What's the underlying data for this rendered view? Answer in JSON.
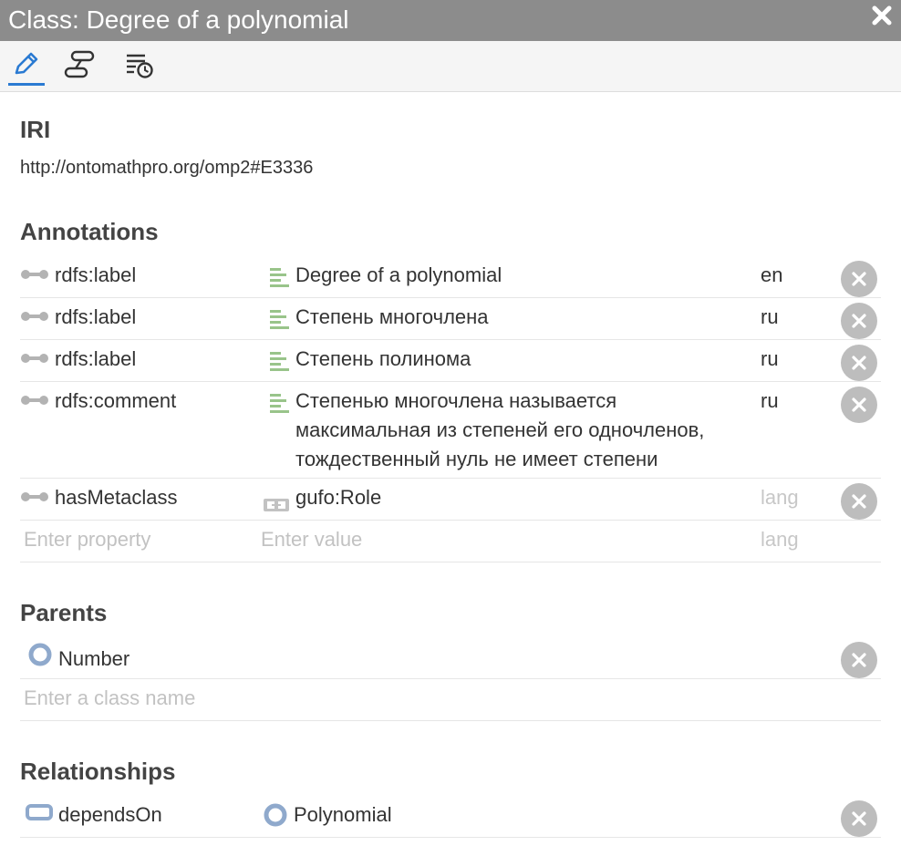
{
  "window": {
    "title": "Class: Degree of a polynomial"
  },
  "tabs": [
    {
      "name": "edit-tab",
      "icon": "pencil-icon"
    },
    {
      "name": "path-tab",
      "icon": "path-icon"
    },
    {
      "name": "history-tab",
      "icon": "history-list-icon"
    }
  ],
  "iri": {
    "heading": "IRI",
    "value": "http://ontomathpro.org/omp2#E3336"
  },
  "annotations": {
    "heading": "Annotations",
    "rows": [
      {
        "property": "rdfs:label",
        "value": "Degree of a polynomial",
        "lang": "en"
      },
      {
        "property": "rdfs:label",
        "value": "Степень многочлена",
        "lang": "ru"
      },
      {
        "property": "rdfs:label",
        "value": "Степень полинома",
        "lang": "ru"
      },
      {
        "property": "rdfs:comment",
        "value_lines": [
          "Степенью многочлена называется",
          "максимальная из степеней его одночленов,",
          "тождественный нуль не имеет степени"
        ],
        "lang": "ru"
      },
      {
        "property": "hasMetaclass",
        "value": "gufo:Role",
        "lang": "lang"
      }
    ],
    "new_row": {
      "property_placeholder": "Enter property",
      "value_placeholder": "Enter value",
      "lang_placeholder": "lang"
    }
  },
  "parents": {
    "heading": "Parents",
    "items": [
      {
        "label": "Number"
      }
    ],
    "placeholder": "Enter a class name"
  },
  "relationships": {
    "heading": "Relationships",
    "items": [
      {
        "property": "dependsOn",
        "target": "Polynomial"
      }
    ]
  },
  "colors": {
    "titlebar": "#8c8c8c",
    "accent": "#2a7ad2",
    "class_icon": "#8fa9cc",
    "literal_icon": "#99c48a",
    "delete_button": "#bdbdbd"
  }
}
